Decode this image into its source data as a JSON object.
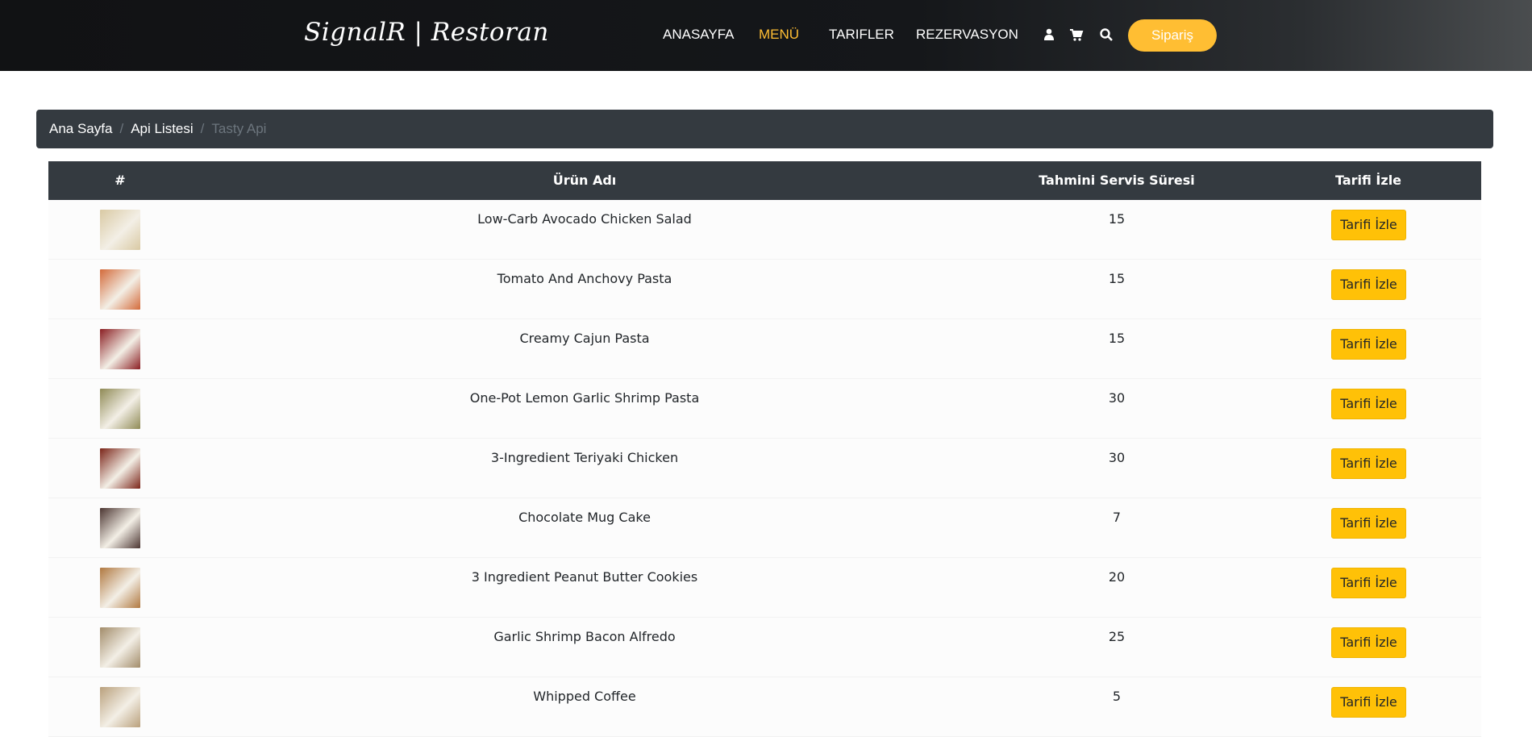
{
  "navbar": {
    "brand": "SignalR | Restoran",
    "links": [
      {
        "label": "ANASAYFA",
        "active": false
      },
      {
        "label": "MENÜ",
        "active": true
      },
      {
        "label": "TARIFLER",
        "active": false
      },
      {
        "label": "REZERVASYON",
        "active": false
      }
    ],
    "icons": [
      "user-icon",
      "cart-icon",
      "search-icon"
    ],
    "order_button": "Sipariş",
    "accent_color": "#ffbe33"
  },
  "breadcrumb": {
    "items": [
      "Ana Sayfa",
      "Api Listesi"
    ],
    "current": "Tasty Api"
  },
  "table": {
    "headers": [
      "#",
      "Ürün Adı",
      "Tahmini Servis Süresi",
      "Tarifi İzle"
    ],
    "button_label": "Tarifi İzle",
    "button_color": "#ffc107",
    "rows": [
      {
        "name": "Low-Carb Avocado Chicken Salad",
        "time": "15",
        "thumb_color": "#d9c9a3"
      },
      {
        "name": "Tomato And Anchovy Pasta",
        "time": "15",
        "thumb_color": "#d36a3a"
      },
      {
        "name": "Creamy Cajun Pasta",
        "time": "15",
        "thumb_color": "#8a1e22"
      },
      {
        "name": "One-Pot Lemon Garlic Shrimp Pasta",
        "time": "30",
        "thumb_color": "#8f8a55"
      },
      {
        "name": "3-Ingredient Teriyaki Chicken",
        "time": "30",
        "thumb_color": "#7a2418"
      },
      {
        "name": "Chocolate Mug Cake",
        "time": "7",
        "thumb_color": "#4b3531"
      },
      {
        "name": "3 Ingredient Peanut Butter Cookies",
        "time": "20",
        "thumb_color": "#b07840"
      },
      {
        "name": "Garlic Shrimp Bacon Alfredo",
        "time": "25",
        "thumb_color": "#a28c6a"
      },
      {
        "name": "Whipped Coffee",
        "time": "5",
        "thumb_color": "#b9a07c"
      }
    ]
  }
}
